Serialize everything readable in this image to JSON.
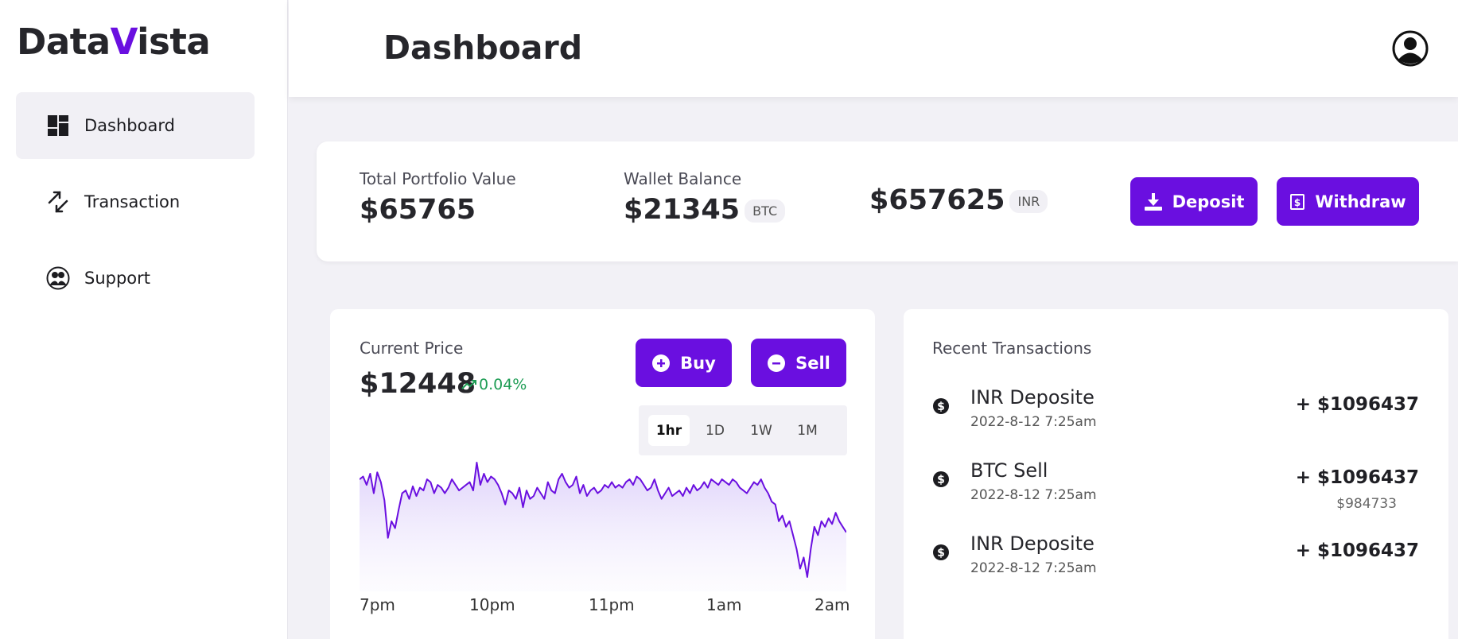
{
  "brand": {
    "logo_part1": "Data",
    "logo_accent": "V",
    "logo_part2": "ista",
    "accent_color": "#6a0fe0"
  },
  "sidebar": {
    "items": [
      {
        "label": "Dashboard",
        "icon": "dashboard-icon",
        "active": true
      },
      {
        "label": "Transaction",
        "icon": "transfer-arrows-icon",
        "active": false
      },
      {
        "label": "Support",
        "icon": "support-people-icon",
        "active": false
      }
    ]
  },
  "header": {
    "title": "Dashboard",
    "profile_icon": "user-avatar-icon"
  },
  "balances": {
    "portfolio_label": "Total Portfolio Value",
    "portfolio_value": "$65765",
    "wallet_label": "Wallet Balance",
    "wallet_btc_value": "$21345",
    "wallet_btc_unit": "BTC",
    "wallet_inr_value": "$657625",
    "wallet_inr_unit": "INR",
    "deposit_label": "Deposit",
    "withdraw_label": "Withdraw"
  },
  "price": {
    "label": "Current Price",
    "value": "$12448",
    "change": "0.04%",
    "change_color": "#1f9d55",
    "buy_label": "Buy",
    "sell_label": "Sell",
    "timeframes": [
      "1hr",
      "1D",
      "1W",
      "1M"
    ],
    "active_timeframe": "1hr"
  },
  "chart_data": {
    "type": "area",
    "x_tick_labels": [
      "7pm",
      "10pm",
      "11pm",
      "1am",
      "2am"
    ],
    "values": [
      70,
      72,
      66,
      74,
      60,
      75,
      68,
      55,
      28,
      40,
      35,
      48,
      60,
      62,
      56,
      65,
      58,
      64,
      62,
      70,
      68,
      60,
      66,
      64,
      60,
      64,
      70,
      66,
      62,
      64,
      66,
      68,
      62,
      82,
      66,
      74,
      68,
      72,
      70,
      66,
      60,
      52,
      62,
      60,
      56,
      64,
      50,
      62,
      56,
      58,
      64,
      60,
      56,
      68,
      62,
      60,
      70,
      74,
      68,
      64,
      66,
      72,
      60,
      66,
      58,
      62,
      64,
      60,
      62,
      66,
      64,
      68,
      64,
      66,
      64,
      68,
      70,
      66,
      72,
      70,
      66,
      62,
      64,
      70,
      62,
      56,
      60,
      64,
      58,
      60,
      62,
      58,
      64,
      60,
      66,
      62,
      64,
      68,
      64,
      70,
      68,
      66,
      70,
      68,
      66,
      70,
      68,
      64,
      62,
      60,
      64,
      68,
      66,
      70,
      64,
      60,
      54,
      52,
      40,
      44,
      36,
      40,
      30,
      20,
      6,
      14,
      0,
      20,
      36,
      30,
      40,
      36,
      42,
      38,
      46,
      40,
      36,
      32
    ]
  },
  "transactions": {
    "title": "Recent Transactions",
    "items": [
      {
        "name": "INR Deposite",
        "date": "2022-8-12 7:25am",
        "amount": "+ $1096437",
        "sub": ""
      },
      {
        "name": "BTC Sell",
        "date": "2022-8-12 7:25am",
        "amount": "+ $1096437",
        "sub": "$984733"
      },
      {
        "name": "INR Deposite",
        "date": "2022-8-12 7:25am",
        "amount": "+ $1096437",
        "sub": ""
      }
    ]
  }
}
